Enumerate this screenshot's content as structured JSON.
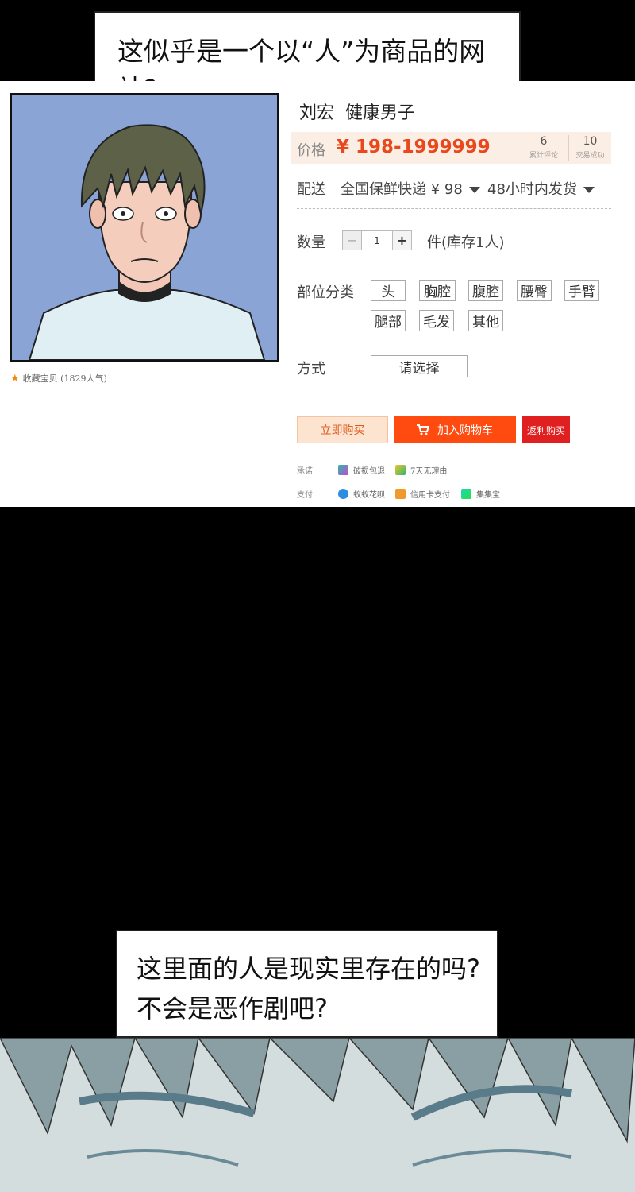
{
  "captions": {
    "top": "这似乎是一个以“人”为商品的网站?",
    "bottom_line1": "这里面的人是现实里存在的吗?",
    "bottom_line2": "不会是恶作剧吧?"
  },
  "product": {
    "favorite": "收藏宝贝 (1829人气)",
    "name": "刘宏",
    "subtitle": "健康男子",
    "price_label": "价格",
    "price": "¥ 198-1999999",
    "reviews_count": "6",
    "reviews_label": "累计评论",
    "deals_count": "10",
    "deals_label": "交易成功",
    "shipping_label": "配送",
    "shipping_method": "全国保鲜快递 ¥ 98",
    "shipping_time": "48小时内发货",
    "quantity_label": "数量",
    "quantity_minus": "−",
    "quantity_value": "1",
    "quantity_plus": "+",
    "stock": "件(库存1人)",
    "parts_label": "部位分类",
    "parts": [
      "头",
      "胸腔",
      "腹腔",
      "腰臀",
      "手臂",
      "腿部",
      "毛发",
      "其他"
    ],
    "method_label": "方式",
    "method_placeholder": "请选择",
    "buy_now": "立即购买",
    "add_to_cart": "加入购物车",
    "rebate_buy": "返利购买",
    "promise_label": "承诺",
    "promise_1": "破损包退",
    "promise_2": "7天无理由",
    "pay_label": "支付",
    "pay_1": "蚁蚁花呗",
    "pay_2": "信用卡支付",
    "pay_3": "集集宝"
  },
  "colors": {
    "price": "#e8481c",
    "cart_button": "#ff4a10",
    "rebate_button": "#e02020",
    "photo_background": "#8aa4d6"
  }
}
